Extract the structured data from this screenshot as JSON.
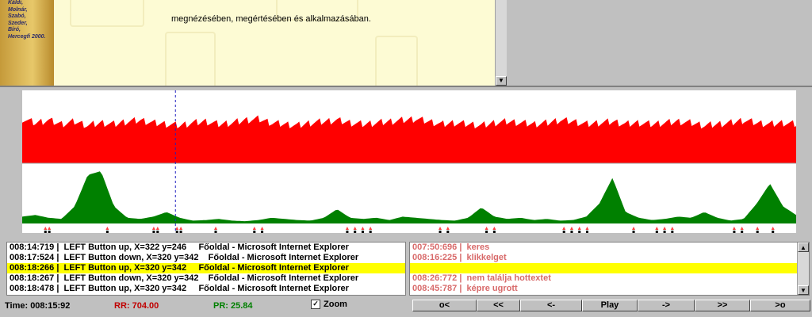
{
  "top": {
    "credits": "Káldi,\nMolnár,\nSzabó,\nSzeder,\nBíró,\nHercegfi 2000.",
    "text": "megnézésében, megértésében és alkalmazásában."
  },
  "logs_left": [
    {
      "time": "008:14:719",
      "text": "LEFT Button up, X=322 y=246     Főoldal - Microsoft Internet Explorer",
      "highlight": false
    },
    {
      "time": "008:17:524",
      "text": "LEFT Button down, X=320 y=342    Főoldal - Microsoft Internet Explorer",
      "highlight": false
    },
    {
      "time": "008:18:266",
      "text": "LEFT Button up, X=320 y=342     Főoldal - Microsoft Internet Explorer",
      "highlight": true
    },
    {
      "time": "008:18:267",
      "text": "LEFT Button down, X=320 y=342    Főoldal - Microsoft Internet Explorer",
      "highlight": false
    },
    {
      "time": "008:18:478",
      "text": "LEFT Button up, X=320 y=342     Főoldal - Microsoft Internet Explorer",
      "highlight": false
    }
  ],
  "logs_right": [
    {
      "time": "007:50:696",
      "text": "keres",
      "highlight": false
    },
    {
      "time": "008:16:225",
      "text": "klikkelget",
      "highlight": false
    },
    {
      "time": "",
      "text": "",
      "highlight": true
    },
    {
      "time": "008:26:772",
      "text": "nem találja hottextet",
      "highlight": false
    },
    {
      "time": "008:45:787",
      "text": "képre ugrott",
      "highlight": false
    }
  ],
  "status": {
    "time": "Time: 008:15:92",
    "rr": "RR:  704.00",
    "pr": "PR:  25.84",
    "zoom_label": "Zoom",
    "zoom_checked": true
  },
  "buttons": [
    "o<",
    "<<",
    "<-",
    "Play",
    "->",
    ">>",
    ">o"
  ],
  "colors": {
    "rr": "#ff0000",
    "pr": "#008000",
    "marker": "#ff4040",
    "highlight": "#ffff00"
  },
  "chart_data": {
    "type": "area",
    "cursor_fraction": 0.198,
    "series": [
      {
        "values": [
          0.68,
          0.62,
          0.66,
          0.6,
          0.64,
          0.58,
          0.62,
          0.6,
          0.64,
          0.66,
          0.62,
          0.6,
          0.58,
          0.62,
          0.64,
          0.6,
          0.62,
          0.66,
          0.68,
          0.62,
          0.6,
          0.58,
          0.62,
          0.64,
          0.66,
          0.62,
          0.6,
          0.62,
          0.64,
          0.66,
          0.68,
          0.64,
          0.6,
          0.62,
          0.6,
          0.58,
          0.62,
          0.64,
          0.62,
          0.6,
          0.62,
          0.66,
          0.64,
          0.6,
          0.62,
          0.64,
          0.6,
          0.62,
          0.6,
          0.62,
          0.64,
          0.62,
          0.58,
          0.6,
          0.62,
          0.66,
          0.62,
          0.6,
          0.62,
          0.6
        ]
      },
      {
        "values": [
          0.12,
          0.15,
          0.1,
          0.08,
          0.3,
          0.85,
          0.92,
          0.3,
          0.1,
          0.08,
          0.12,
          0.2,
          0.1,
          0.05,
          0.06,
          0.08,
          0.05,
          0.04,
          0.06,
          0.1,
          0.08,
          0.06,
          0.05,
          0.1,
          0.25,
          0.1,
          0.08,
          0.1,
          0.06,
          0.12,
          0.1,
          0.08,
          0.06,
          0.05,
          0.1,
          0.28,
          0.12,
          0.08,
          0.1,
          0.06,
          0.08,
          0.05,
          0.06,
          0.12,
          0.35,
          0.8,
          0.2,
          0.1,
          0.06,
          0.08,
          0.12,
          0.1,
          0.2,
          0.1,
          0.05,
          0.08,
          0.35,
          0.7,
          0.3,
          0.15
        ]
      }
    ],
    "markers": [
      0.03,
      0.035,
      0.11,
      0.17,
      0.175,
      0.2,
      0.205,
      0.25,
      0.3,
      0.31,
      0.42,
      0.43,
      0.44,
      0.45,
      0.54,
      0.55,
      0.6,
      0.61,
      0.7,
      0.71,
      0.72,
      0.73,
      0.79,
      0.82,
      0.83,
      0.84,
      0.92,
      0.93,
      0.95,
      0.97
    ]
  }
}
